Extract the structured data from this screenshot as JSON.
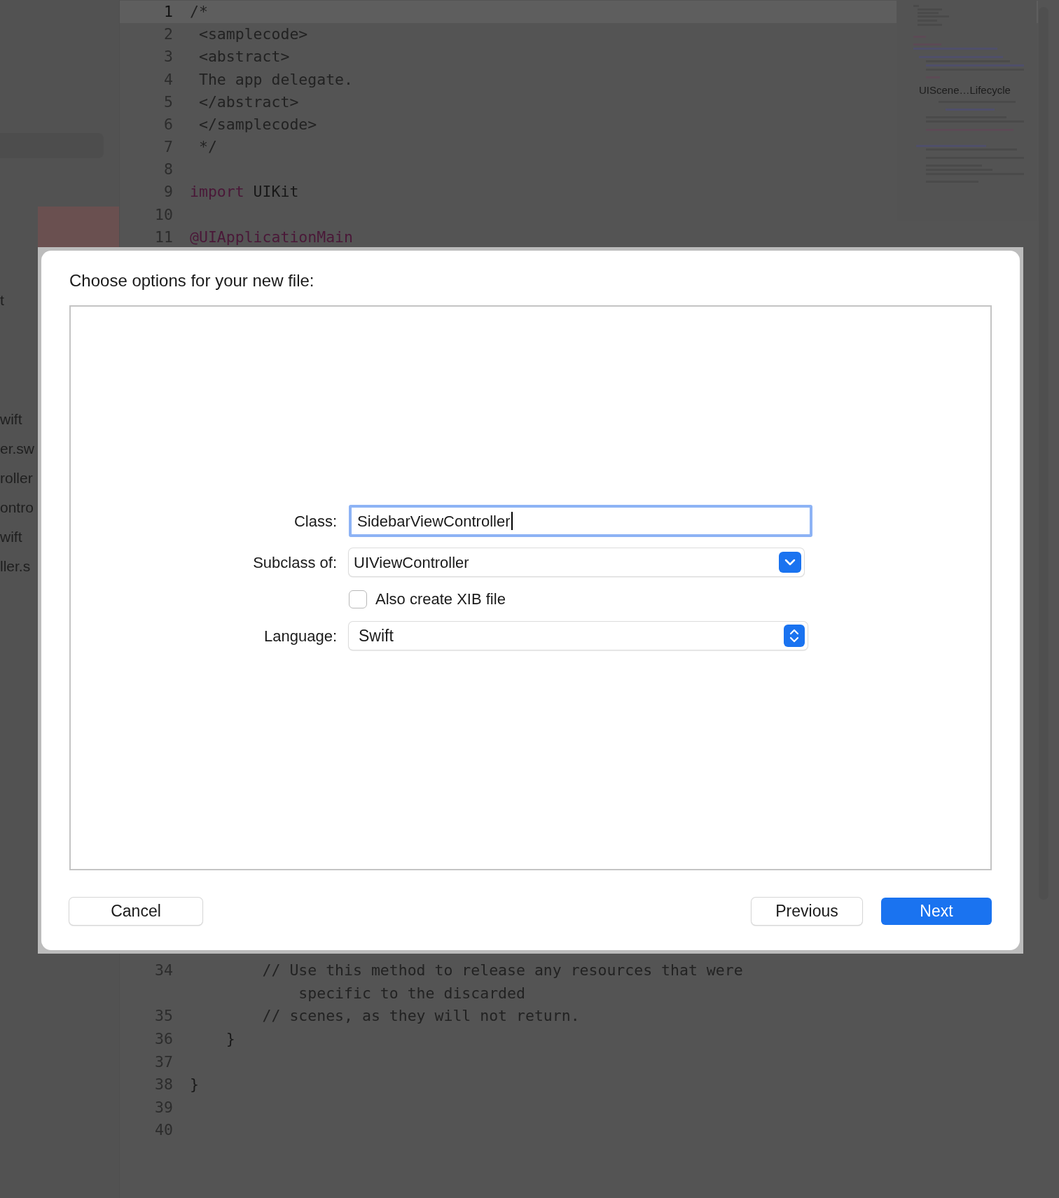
{
  "sidebar": {
    "items": [
      {
        "label": "t",
        "selected": false
      },
      {
        "label": "wift",
        "selected": false
      },
      {
        "label": "er.sw",
        "selected": false
      },
      {
        "label": "roller",
        "selected": false
      },
      {
        "label": "ontro",
        "selected": false
      },
      {
        "label": "wift",
        "selected": false
      },
      {
        "label": "ller.s",
        "selected": false
      }
    ]
  },
  "editor": {
    "top_lines": [
      {
        "number": "1",
        "current": true,
        "tokens": [
          {
            "text": "/*",
            "kind": "comment"
          }
        ]
      },
      {
        "number": "2",
        "current": false,
        "tokens": [
          {
            "text": " <samplecode>",
            "kind": "comment"
          }
        ]
      },
      {
        "number": "3",
        "current": false,
        "tokens": [
          {
            "text": " <abstract>",
            "kind": "comment"
          }
        ]
      },
      {
        "number": "4",
        "current": false,
        "tokens": [
          {
            "text": " The app delegate.",
            "kind": "comment"
          }
        ]
      },
      {
        "number": "5",
        "current": false,
        "tokens": [
          {
            "text": " </abstract>",
            "kind": "comment"
          }
        ]
      },
      {
        "number": "6",
        "current": false,
        "tokens": [
          {
            "text": " </samplecode>",
            "kind": "comment"
          }
        ]
      },
      {
        "number": "7",
        "current": false,
        "tokens": [
          {
            "text": " */",
            "kind": "comment"
          }
        ]
      },
      {
        "number": "8",
        "current": false
      },
      {
        "number": "9",
        "current": false,
        "tokens": [
          {
            "text": "import",
            "kind": "keyword"
          },
          {
            "text": " UIKit",
            "kind": "plain"
          }
        ]
      },
      {
        "number": "10",
        "current": false
      },
      {
        "number": "11",
        "current": false,
        "tokens": [
          {
            "text": "@UIApplicationMain",
            "kind": "keyword"
          }
        ]
      }
    ],
    "bottom_lines": [
      {
        "number": "34",
        "current": false,
        "tokens": [
          {
            "text": "        // Use this method to release any resources that were",
            "kind": "comment"
          }
        ],
        "continuation": "            specific to the discarded"
      },
      {
        "number": "35",
        "current": false,
        "tokens": [
          {
            "text": "        // scenes, as they will not return.",
            "kind": "comment"
          }
        ]
      },
      {
        "number": "36",
        "current": false,
        "tokens": [
          {
            "text": "    }",
            "kind": "plain"
          }
        ]
      },
      {
        "number": "37",
        "current": false
      },
      {
        "number": "38",
        "current": false,
        "tokens": [
          {
            "text": "}",
            "kind": "plain"
          }
        ]
      },
      {
        "number": "39",
        "current": false
      },
      {
        "number": "40",
        "current": false
      }
    ],
    "minimap": {
      "label": "UIScene…Lifecycle"
    }
  },
  "dialog": {
    "title": "Choose options for your new file:",
    "fields": [
      {
        "kind": "text",
        "label": "Class:",
        "value": "SidebarViewController",
        "focused": true
      },
      {
        "kind": "popup",
        "label": "Subclass of:",
        "value": "UIViewController"
      },
      {
        "kind": "checkbox",
        "label": "Also create XIB file",
        "checked": false
      },
      {
        "kind": "stepper",
        "label": "Language:",
        "value": "Swift"
      }
    ],
    "buttons": [
      {
        "label": "Cancel",
        "primary": false
      },
      {
        "label": "Previous",
        "primary": false
      },
      {
        "label": "Next",
        "primary": true
      }
    ]
  }
}
